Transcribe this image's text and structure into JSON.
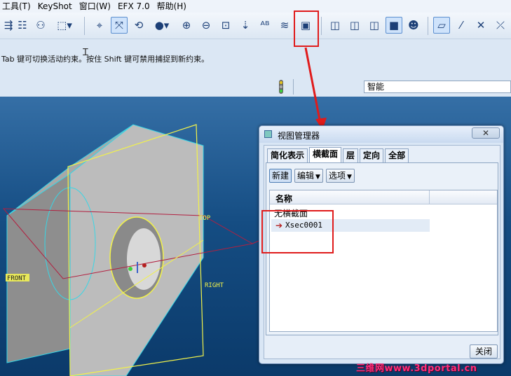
{
  "menu": [
    "工具(T)",
    "KeyShot",
    "窗口(W)",
    "EFX 7.0",
    "帮助(H)"
  ],
  "toolbar_icons": [
    "repaint-icon",
    "layers-rebuild-icon",
    "binoculars-icon",
    "selection-box-icon",
    "spin-center-icon",
    "datum-display-icon",
    "orient-icon",
    "sphere-shading-icon",
    "zoom-in-icon",
    "zoom-out-icon",
    "refit-icon",
    "view-normal-icon",
    "text-style-icon",
    "layers-icon",
    "view-manager-icon",
    "wireframe-icon",
    "hidden-line-icon",
    "no-hidden-icon",
    "shading-icon",
    "enhanced-realism-icon",
    "plane-display-icon",
    "axis-display-icon",
    "point-display-icon",
    "csys-display-icon"
  ],
  "status": {
    "prompt": "Tab 键可切换活动约束。按住 Shift 键可禁用捕捉到新约束。",
    "filter_value": "智能"
  },
  "model_labels": {
    "top": "TOP",
    "front": "FRONT",
    "right": "RIGHT"
  },
  "dialog": {
    "title": "视图管理器",
    "close_x": "✕",
    "tabs": [
      "简化表示",
      "横截面",
      "层",
      "定向",
      "全部"
    ],
    "active_tab": "横截面",
    "buttons": {
      "new": "新建",
      "edit": "编辑",
      "options": "选项"
    },
    "list": {
      "column_name": "名称",
      "rows": [
        "无横截面",
        "Xsec0001"
      ]
    },
    "close_button": "关闭"
  },
  "watermark": "三维网www.3dportal.cn",
  "colors": {
    "highlight": "#e01b1b",
    "viewport_top": "#356fa6",
    "viewport_bottom": "#0b3a6a",
    "model_face": "#b9b9b9",
    "datum_plane": "#f2f24a",
    "datum_edge": "#b22040",
    "edge_highlight": "#37d7e6"
  }
}
